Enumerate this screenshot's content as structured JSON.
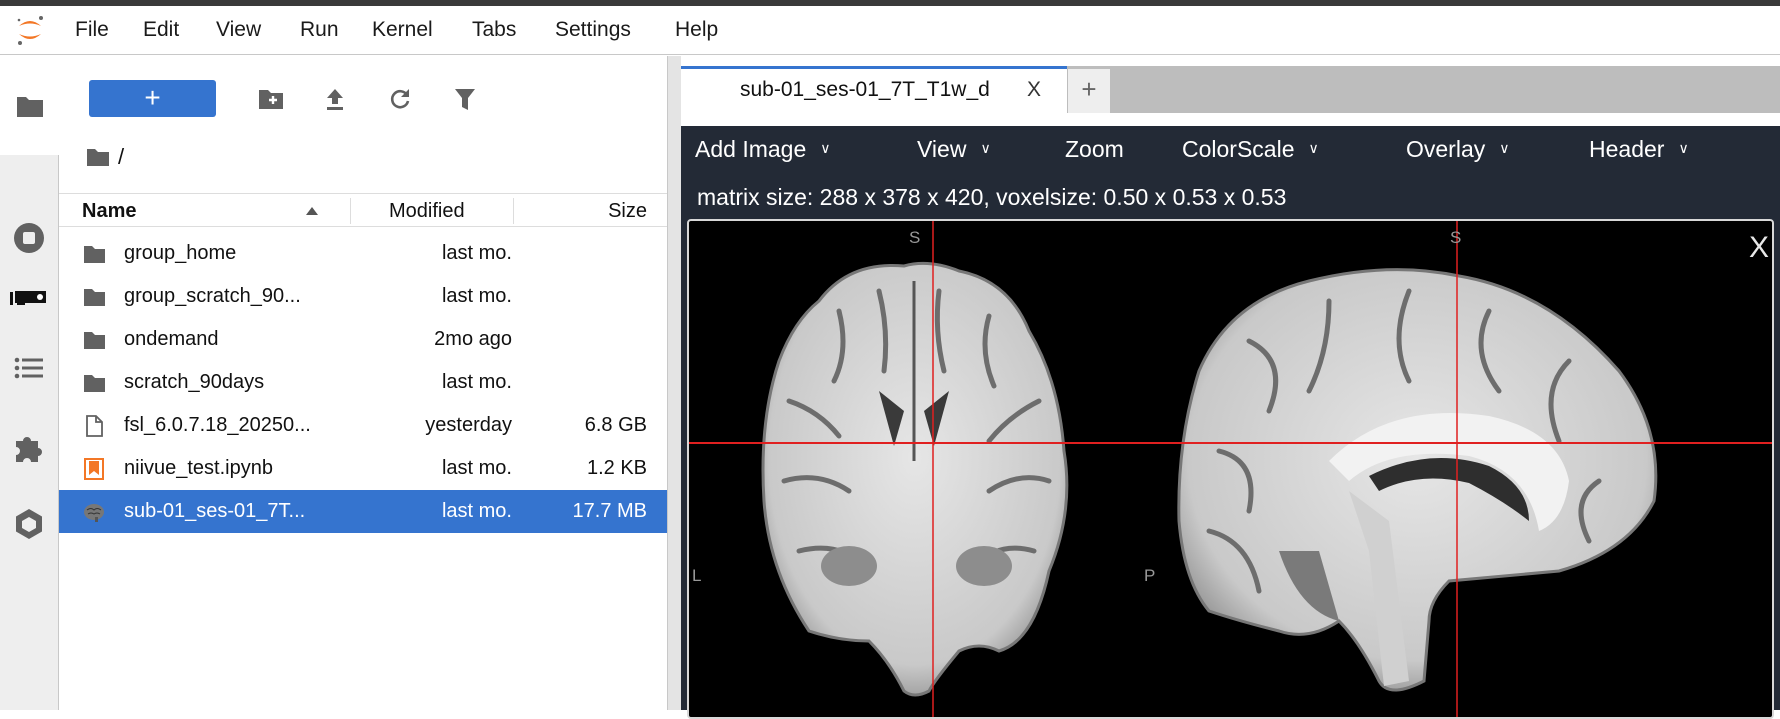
{
  "menubar": {
    "items": [
      "File",
      "Edit",
      "View",
      "Run",
      "Kernel",
      "Tabs",
      "Settings",
      "Help"
    ]
  },
  "filebrowser": {
    "new_label": "+",
    "breadcrumb": "/",
    "columns": {
      "name": "Name",
      "modified": "Modified",
      "size": "Size"
    },
    "rows": [
      {
        "name": "group_home",
        "modified": "last mo.",
        "size": "",
        "type": "folder"
      },
      {
        "name": "group_scratch_90...",
        "modified": "last mo.",
        "size": "",
        "type": "folder"
      },
      {
        "name": "ondemand",
        "modified": "2mo ago",
        "size": "",
        "type": "folder"
      },
      {
        "name": "scratch_90days",
        "modified": "last mo.",
        "size": "",
        "type": "folder"
      },
      {
        "name": "fsl_6.0.7.18_20250...",
        "modified": "yesterday",
        "size": "6.8 GB",
        "type": "file"
      },
      {
        "name": "niivue_test.ipynb",
        "modified": "last mo.",
        "size": "1.2 KB",
        "type": "notebook"
      },
      {
        "name": "sub-01_ses-01_7T...",
        "modified": "last mo.",
        "size": "17.7 MB",
        "type": "nifti",
        "selected": true
      }
    ]
  },
  "dock": {
    "tab_label": "sub-01_ses-01_7T_T1w_d",
    "tab_close": "X",
    "add_tab": "+"
  },
  "niivue": {
    "menus": [
      "Add Image",
      "View",
      "Zoom",
      "ColorScale",
      "Overlay",
      "Header"
    ],
    "info": "matrix size: 288 x 378 x 420, voxelsize: 0.50 x 0.53 x 0.53",
    "labels": {
      "s1": "S",
      "s2": "S",
      "l": "L",
      "p": "P",
      "close": "X"
    },
    "crosshair_color": "#e02020"
  },
  "colors": {
    "accent": "#3574cf",
    "toolbar": "#232a36",
    "logo": "#f37726"
  }
}
